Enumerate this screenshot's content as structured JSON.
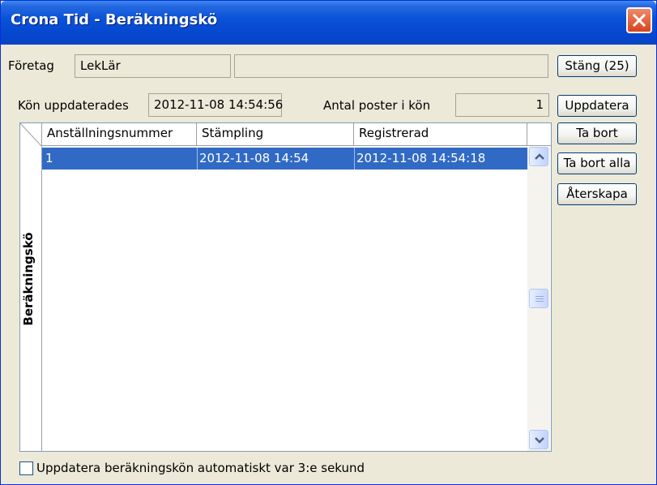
{
  "window": {
    "title": "Crona Tid - Beräkningskö",
    "close_icon": "close-icon"
  },
  "company": {
    "label": "Företag",
    "code": "LekLär",
    "name": ""
  },
  "buttons": {
    "close": "Stäng (25)",
    "update": "Uppdatera",
    "remove": "Ta bort",
    "remove_all": "Ta bort alla",
    "restore": "Återskapa"
  },
  "queue_updated": {
    "label": "Kön uppdaterades",
    "value": "2012-11-08 14:54:56"
  },
  "queue_count": {
    "label": "Antal poster i kön",
    "value": "1"
  },
  "table": {
    "side_label": "Beräkningskö",
    "columns": [
      "Anställningsnummer",
      "Stämpling",
      "Registrerad"
    ],
    "rows": [
      {
        "employee": "1",
        "stamp": "2012-11-08 14:54",
        "registered": "2012-11-08 14:54:18",
        "selected": true
      }
    ]
  },
  "auto_update": {
    "label": "Uppdatera beräkningskön automatiskt var 3:e sekund",
    "checked": false
  },
  "colors": {
    "title_bar": "#0a53d8",
    "selection": "#316ac5",
    "window_bg": "#ece9d8",
    "close_button": "#d8431d"
  }
}
